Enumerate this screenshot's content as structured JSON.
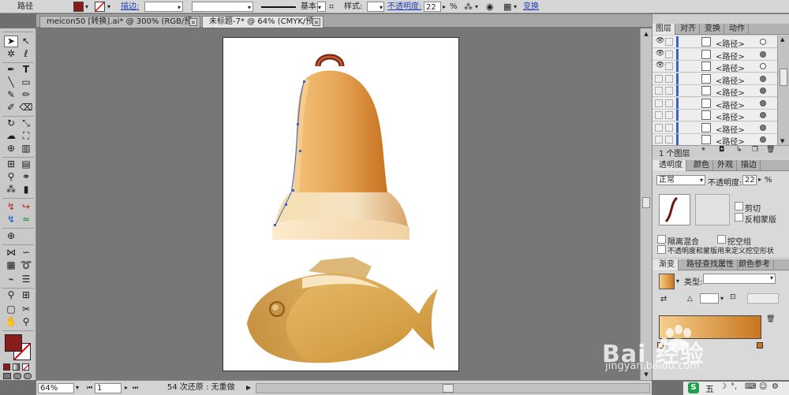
{
  "control_bar": {
    "object_type": "路径",
    "fill_color": "#8b1a1a",
    "stroke_label": "描边:",
    "stroke_width": "",
    "brush_label": "基本",
    "style_label": "样式:",
    "opacity_label": "不透明度:",
    "opacity_value": "22",
    "opacity_unit": "%",
    "transform_link": "变换"
  },
  "doc_tabs": [
    {
      "label": "meicon50 [转换].ai* @ 300% (RGB/预览)",
      "active": false
    },
    {
      "label": "未标题-7* @ 64% (CMYK/预览)",
      "active": true
    }
  ],
  "tools": [
    "selection-tool",
    "direct-selection-tool",
    "magic-wand-tool",
    "lasso-tool",
    "pen-tool",
    "type-tool",
    "line-tool",
    "rectangle-tool",
    "paintbrush-tool",
    "pencil-tool",
    "blob-brush-tool",
    "eraser-tool",
    "rotate-tool",
    "scale-tool",
    "warp-tool",
    "free-transform-tool",
    "shape-builder-tool",
    "perspective-grid-tool",
    "mesh-tool",
    "gradient-tool",
    "eyedropper-tool",
    "blend-tool",
    "symbol-sprayer-tool",
    "column-graph-tool",
    "path-tool-1",
    "path-tool-2",
    "path-tool-3",
    "path-tool-4",
    "target-tool",
    "artboard-tool",
    "slice-tool",
    "width-tool",
    "puppet-tool",
    "graph-tool",
    "sort-tool",
    "list-tool",
    "eyedropper-tool-2",
    "measure-tool",
    "crop-tool",
    "knife-tool",
    "hand-tool",
    "zoom-tool"
  ],
  "colors": {
    "fill": "#8b1a1a",
    "stroke": "#ffffff",
    "accent": "#3a62c9"
  },
  "status_bar": {
    "zoom": "64%",
    "page": "1",
    "undo_info": "54 次还原 : 无重做"
  },
  "layers_panel": {
    "tabs": [
      "图层",
      "对齐",
      "变换",
      "动作"
    ],
    "rows": [
      "<路径>",
      "<路径>",
      "<路径>",
      "<路径>",
      "<路径>",
      "<路径>",
      "<路径>",
      "<路径>",
      "<路径>"
    ],
    "footer": "1 个图层"
  },
  "transparency_panel": {
    "tabs": [
      "透明度",
      "颜色",
      "外观",
      "描边"
    ],
    "blend_mode": "正常",
    "opacity_label": "不透明度:",
    "opacity_value": "22",
    "opacity_unit": "%",
    "clip_label": "剪切",
    "invert_mask_label": "反相蒙版",
    "isolate_blending_label": "隔离混合",
    "knockout_group_label": "挖空组",
    "opacity_mask_label": "不透明度和蒙版用来定义挖空形状"
  },
  "gradient_panel": {
    "tabs": [
      "渐变",
      "路径查找",
      "属性",
      "颜色参考"
    ],
    "type_label": "类型:",
    "angle_value": "",
    "opacity_value": "",
    "start_color": "#f6cf8e",
    "end_color": "#c9761d"
  },
  "watermark": {
    "text": "Bai 经验",
    "url": "jingyan.baidu.com"
  },
  "taskbar": {
    "ime_label": "五"
  }
}
